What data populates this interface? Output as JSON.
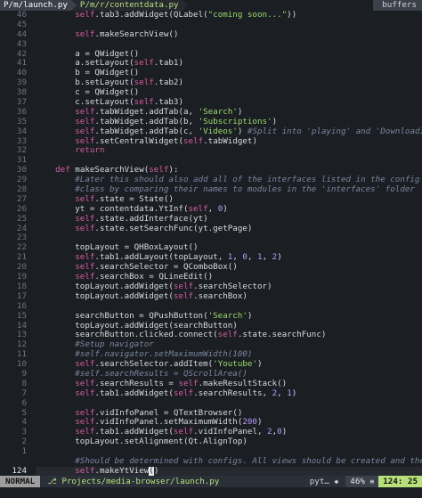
{
  "tabs": [
    {
      "label": "P/m/launch.py"
    },
    {
      "label": "P/m/r/contentdata.py"
    }
  ],
  "buffers_label": "buffers",
  "lines": [
    {
      "n": "46",
      "cur": false,
      "html": "        <span class='sf'>self</span>.tab3.addWidget(QLabel(<span class='s'>\"coming soon...\"</span>))"
    },
    {
      "n": "45",
      "cur": false,
      "html": ""
    },
    {
      "n": "44",
      "cur": false,
      "html": "        <span class='sf'>self</span>.makeSearchView()"
    },
    {
      "n": "43",
      "cur": false,
      "html": ""
    },
    {
      "n": "42",
      "cur": false,
      "html": "        a = QWidget()"
    },
    {
      "n": "41",
      "cur": false,
      "html": "        a.setLayout(<span class='sf'>self</span>.tab1)"
    },
    {
      "n": "40",
      "cur": false,
      "html": "        b = QWidget()"
    },
    {
      "n": "39",
      "cur": false,
      "html": "        b.setLayout(<span class='sf'>self</span>.tab2)"
    },
    {
      "n": "38",
      "cur": false,
      "html": "        c = QWidget()"
    },
    {
      "n": "37",
      "cur": false,
      "html": "        c.setLayout(<span class='sf'>self</span>.tab3)"
    },
    {
      "n": "36",
      "cur": false,
      "html": "        <span class='sf'>self</span>.tabWidget.addTab(a, <span class='s'>'Search'</span>)"
    },
    {
      "n": "35",
      "cur": false,
      "html": "        <span class='sf'>self</span>.tabWidget.addTab(b, <span class='s'>'Subscriptions'</span>)"
    },
    {
      "n": "34",
      "cur": false,
      "html": "        <span class='sf'>self</span>.tabWidget.addTab(c, <span class='s'>'Videos'</span>) <span class='c'>#Split into 'playing' and 'Downloading'</span>"
    },
    {
      "n": "33",
      "cur": false,
      "html": "        <span class='sf'>self</span>.setCentralWidget(<span class='sf'>self</span>.tabWidget)"
    },
    {
      "n": "32",
      "cur": false,
      "html": "        <span class='k'>return</span>"
    },
    {
      "n": "31",
      "cur": false,
      "html": ""
    },
    {
      "n": "30",
      "cur": false,
      "html": "    <span class='k'>def</span> makeSearchView(<span class='sf'>self</span>):"
    },
    {
      "n": "29",
      "cur": false,
      "html": "        <span class='c'>#Later this should also add all of the interfaces listed in the config</span>"
    },
    {
      "n": "28",
      "cur": false,
      "html": "        <span class='c'>#class by comparing their names to modules in the 'interfaces' folder</span>"
    },
    {
      "n": "27",
      "cur": false,
      "html": "        <span class='sf'>self</span>.state = State()"
    },
    {
      "n": "26",
      "cur": false,
      "html": "        yt = contentdata.YtInf(<span class='sf'>self</span>, <span class='n'>0</span>)"
    },
    {
      "n": "25",
      "cur": false,
      "html": "        <span class='sf'>self</span>.state.addInterface(yt)"
    },
    {
      "n": "24",
      "cur": false,
      "html": "        <span class='sf'>self</span>.state.setSearchFunc(yt.getPage)"
    },
    {
      "n": "23",
      "cur": false,
      "html": ""
    },
    {
      "n": "22",
      "cur": false,
      "html": "        topLayout = QHBoxLayout()"
    },
    {
      "n": "21",
      "cur": false,
      "html": "        <span class='sf'>self</span>.tab1.addLayout(topLayout, <span class='n'>1</span>, <span class='n'>0</span>, <span class='n'>1</span>, <span class='n'>2</span>)"
    },
    {
      "n": "20",
      "cur": false,
      "html": "        <span class='sf'>self</span>.searchSelector = QComboBox()"
    },
    {
      "n": "19",
      "cur": false,
      "html": "        <span class='sf'>self</span>.searchBox = QLineEdit()"
    },
    {
      "n": "18",
      "cur": false,
      "html": "        topLayout.addWidget(<span class='sf'>self</span>.searchSelector)"
    },
    {
      "n": "17",
      "cur": false,
      "html": "        topLayout.addWidget(<span class='sf'>self</span>.searchBox)"
    },
    {
      "n": "16",
      "cur": false,
      "html": ""
    },
    {
      "n": "15",
      "cur": false,
      "html": "        searchButton = QPushButton(<span class='s'>'Search'</span>)"
    },
    {
      "n": "14",
      "cur": false,
      "html": "        topLayout.addWidget(searchButton)"
    },
    {
      "n": "13",
      "cur": false,
      "html": "        searchButton.clicked.connect(<span class='sf'>self</span>.state.searchFunc)"
    },
    {
      "n": "12",
      "cur": false,
      "html": "        <span class='c'>#Setup navigator</span>"
    },
    {
      "n": "11",
      "cur": false,
      "html": "        <span class='c'>#self.navigator.setMaximumWidth(100)</span>"
    },
    {
      "n": "10",
      "cur": false,
      "html": "        <span class='sf'>self</span>.searchSelector.addItem(<span class='s'>'Youtube'</span>)"
    },
    {
      "n": "9",
      "cur": false,
      "html": "        <span class='c'>#self.searchResults = QScrollArea()</span>"
    },
    {
      "n": "8",
      "cur": false,
      "html": "        <span class='sf'>self</span>.searchResults = <span class='sf'>self</span>.makeResultStack()"
    },
    {
      "n": "7",
      "cur": false,
      "html": "        <span class='sf'>self</span>.tab1.addWidget(<span class='sf'>self</span>.searchResults, <span class='n'>2</span>, <span class='n'>1</span>)"
    },
    {
      "n": "6",
      "cur": false,
      "html": ""
    },
    {
      "n": "5",
      "cur": false,
      "html": "        <span class='sf'>self</span>.vidInfoPanel = QTextBrowser()"
    },
    {
      "n": "4",
      "cur": false,
      "html": "        <span class='sf'>self</span>.vidInfoPanel.setMaximumWidth(<span class='n'>200</span>)"
    },
    {
      "n": "3",
      "cur": false,
      "html": "        <span class='sf'>self</span>.tab1.addWidget(<span class='sf'>self</span>.vidInfoPanel, <span class='n'>2</span>,<span class='n'>0</span>)"
    },
    {
      "n": "2",
      "cur": false,
      "html": "        topLayout.setAlignment(Qt.AlignTop)"
    },
    {
      "n": "1",
      "cur": false,
      "html": ""
    },
    {
      "n": "",
      "cur": false,
      "html": "        <span class='c'>#Should be determined with configs. All views should be created and the</span>"
    },
    {
      "n": "124",
      "cur": true,
      "html": "        <span class='sf'>self</span>.makeYtView<span class='cursor'>(</span>)"
    }
  ],
  "modeline": {
    "mode": "NORMAL",
    "file": "Projects/media-browser/launch.py",
    "filetype": "pyt…",
    "percent": "46%",
    "position": "124: 25"
  },
  "colors": {
    "background": "#1b1e23",
    "keyword": "#d65da0",
    "string": "#9adb6a",
    "number": "#b89cf5",
    "comment": "#7a86a0",
    "accent": "#b7e07a"
  }
}
